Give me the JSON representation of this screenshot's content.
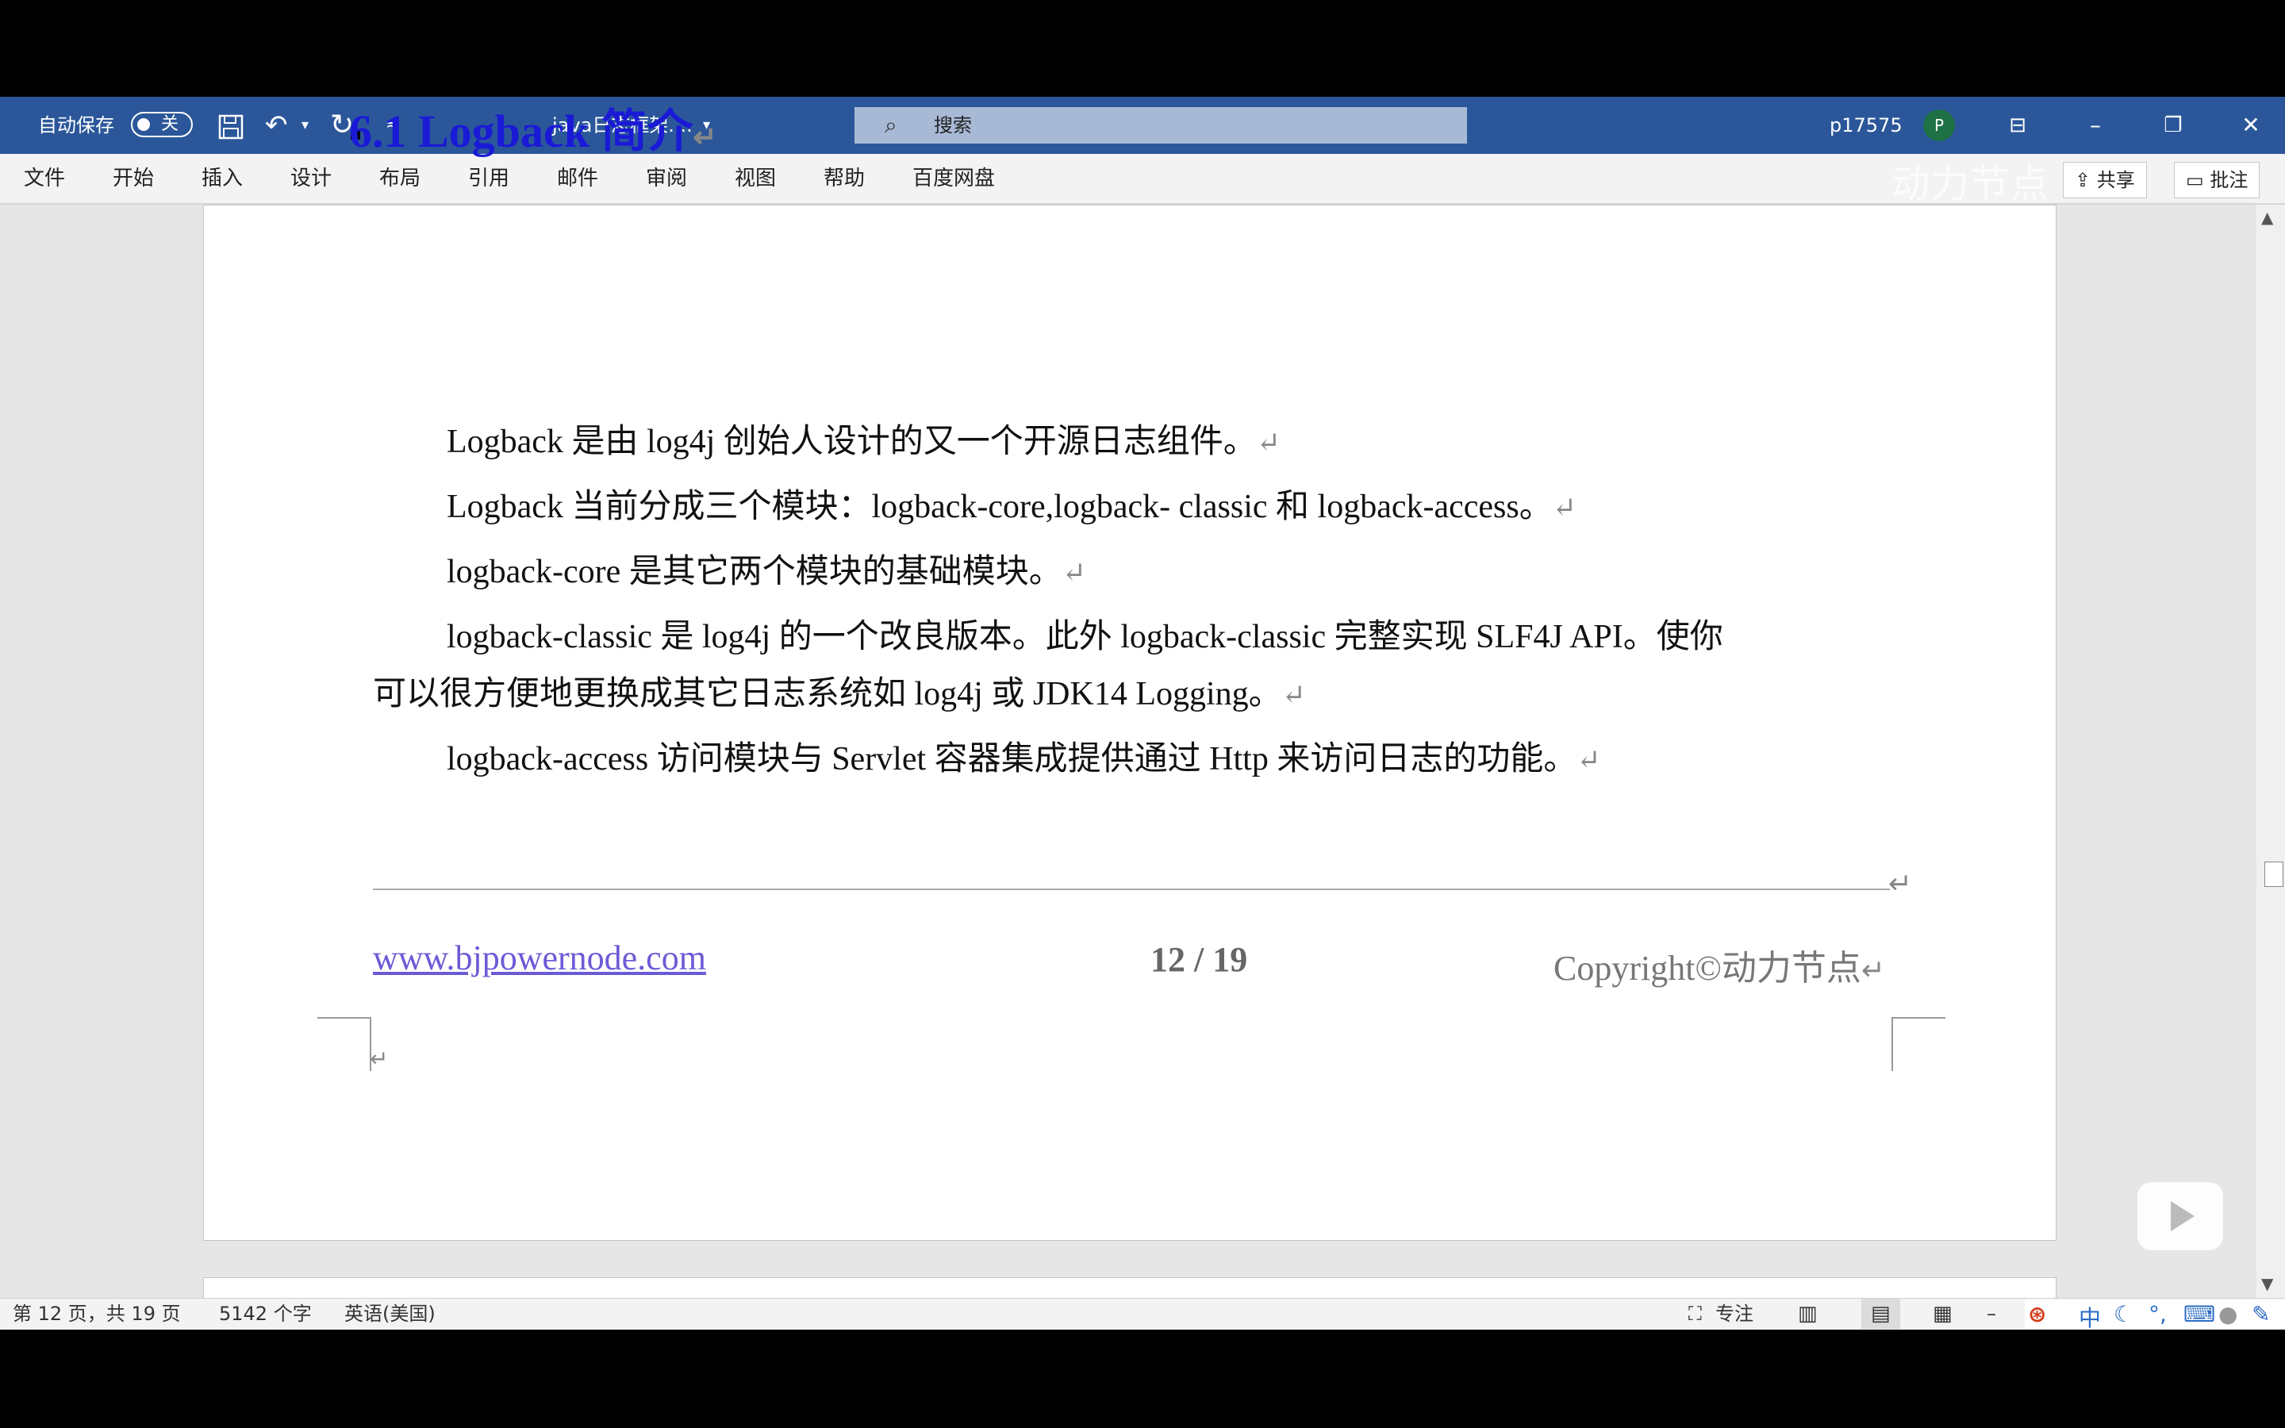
{
  "titlebar": {
    "autosave_label": "自动保存",
    "autosave_state": "关",
    "doc_title": "java日志框架....",
    "search_placeholder": "搜索",
    "user": "p17575",
    "avatar_letter": "P"
  },
  "menu": [
    "文件",
    "开始",
    "插入",
    "设计",
    "布局",
    "引用",
    "邮件",
    "审阅",
    "视图",
    "帮助",
    "百度网盘"
  ],
  "ribbon_buttons": {
    "share": "共享",
    "comment": "批注"
  },
  "watermark": "动力节点",
  "document": {
    "heading": "6.1 Logback 简介",
    "paragraphs": [
      "Logback 是由 log4j 创始人设计的又一个开源日志组件。",
      "Logback 当前分成三个模块：logback-core,logback- classic 和 logback-access。",
      "logback-core 是其它两个模块的基础模块。",
      "logback-classic 是 log4j 的一个改良版本。此外 logback-classic 完整实现 SLF4J  API。使你",
      "可以很方便地更换成其它日志系统如 log4j 或 JDK14 Logging。",
      "logback-access 访问模块与 Servlet 容器集成提供通过 Http 来访问日志的功能。"
    ],
    "paragraph_mark": "↵",
    "footer": {
      "url": "www.bjpowernode.com",
      "page": "12  /  19",
      "copyright": "Copyright©动力节点"
    }
  },
  "statusbar": {
    "page_info": "第 12 页，共 19 页",
    "word_count": "5142 个字",
    "language": "英语(美国)",
    "focus": "专注"
  },
  "ime": {
    "mode": "中"
  },
  "colors": {
    "title_bar": "#2b579a",
    "heading": "#1a1ad6",
    "link": "#6b5bd6"
  }
}
